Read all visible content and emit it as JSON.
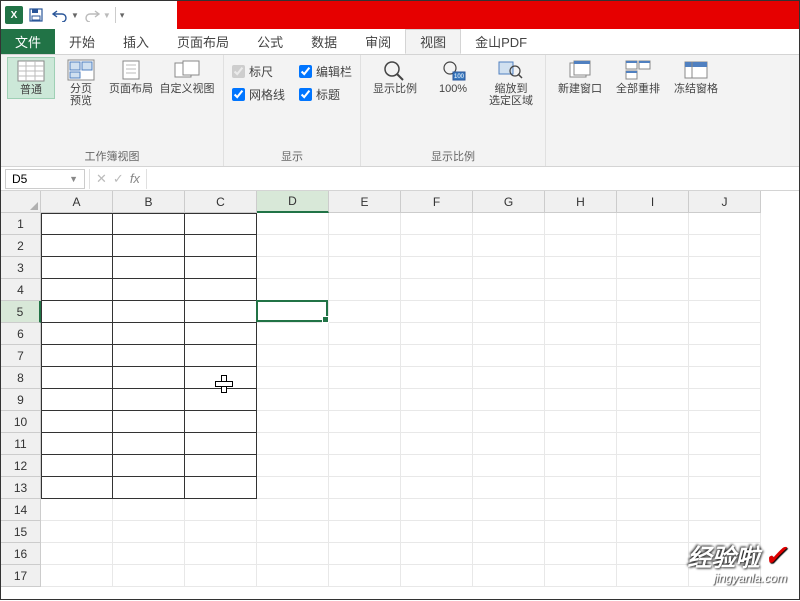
{
  "qat": {
    "save_title": "保存",
    "undo_title": "撤销",
    "redo_title": "重做"
  },
  "tabs": {
    "file": "文件",
    "home": "开始",
    "insert": "插入",
    "layout": "页面布局",
    "formulas": "公式",
    "data": "数据",
    "review": "审阅",
    "view": "视图",
    "wps": "金山PDF"
  },
  "ribbon": {
    "views_group": "工作簿视图",
    "normal": "普通",
    "page_break": "分页\n预览",
    "page_layout": "页面布局",
    "custom_views": "自定义视图",
    "show_group": "显示",
    "ruler": "标尺",
    "formula_bar": "编辑栏",
    "gridlines": "网格线",
    "headings": "标题",
    "zoom_group": "显示比例",
    "zoom": "显示比例",
    "hundred": "100%",
    "zoom_sel": "缩放到\n选定区域",
    "new_window": "新建窗口",
    "arrange": "全部重排",
    "freeze": "冻结窗格"
  },
  "namebox": {
    "value": "D5"
  },
  "sheet": {
    "columns": [
      "A",
      "B",
      "C",
      "D",
      "E",
      "F",
      "G",
      "H",
      "I",
      "J"
    ],
    "rows": [
      1,
      2,
      3,
      4,
      5,
      6,
      7,
      8,
      9,
      10,
      11,
      12,
      13,
      14,
      15,
      16,
      17
    ],
    "active_col": 3,
    "active_row": 4,
    "bordered_cols": 3,
    "bordered_rows": 13
  },
  "watermark": {
    "main": "经验啦",
    "sub": "jingyanla.com"
  }
}
